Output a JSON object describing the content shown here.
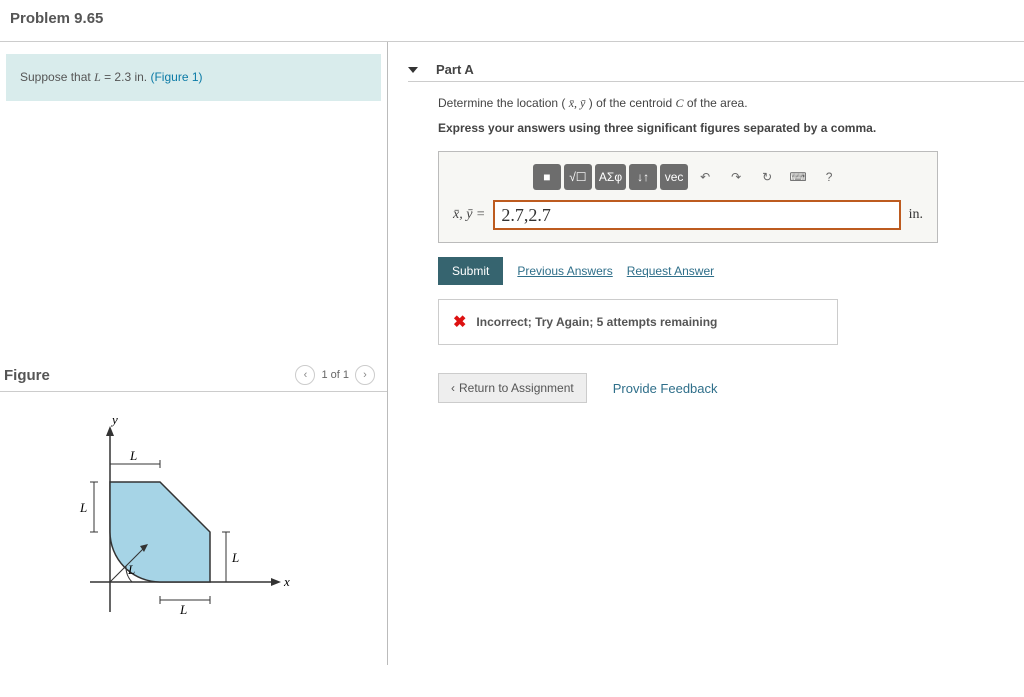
{
  "problem_title": "Problem 9.65",
  "suppose": {
    "prefix": "Suppose that ",
    "var": "L",
    "eq": " = 2.3 ",
    "unit": "in.",
    "figlink": "(Figure 1)"
  },
  "figure": {
    "label": "Figure",
    "counter": "1 of 1",
    "labels": {
      "y": "y",
      "x": "x",
      "L": "L"
    }
  },
  "partA": {
    "header": "Part A",
    "desc_pre": "Determine the location ( ",
    "desc_vars": "x̄, ȳ",
    "desc_mid": ") of the centroid ",
    "desc_C": "C",
    "desc_post": " of the area.",
    "instruct": "Express your answers using three significant figures separated by a comma.",
    "toolbar": {
      "t1": "■",
      "t2": "√☐",
      "t3": "ΑΣφ",
      "t4": "↓↑",
      "t5": "vec",
      "t6": "↶",
      "t7": "↷",
      "t8": "↻",
      "t9": "⌨",
      "t10": "?"
    },
    "prefix_vars": "x̄, ȳ = ",
    "answer_value": "2.7,2.7",
    "unit": "in.",
    "submit": "Submit",
    "prev_answers": "Previous Answers",
    "req_answer": "Request Answer",
    "feedback": "Incorrect; Try Again; 5 attempts remaining"
  },
  "bottom": {
    "return": "Return to Assignment",
    "provide": "Provide Feedback"
  }
}
